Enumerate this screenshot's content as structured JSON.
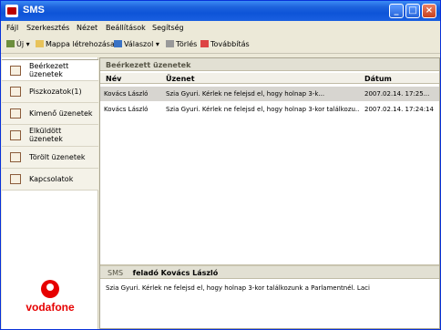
{
  "window": {
    "title": "SMS"
  },
  "menu": [
    "Fájl",
    "Szerkesztés",
    "Nézet",
    "Beállítások",
    "Segítség"
  ],
  "toolbar": {
    "new_label": "Új",
    "new_folder_label": "Mappa létrehozása",
    "reply_label": "Válaszol",
    "delete_label": "Törlés",
    "forward_label": "Továbbítás"
  },
  "sidebar": {
    "items": [
      {
        "label": "Beérkezett üzenetek",
        "active": true
      },
      {
        "label": "Piszkozatok(1)"
      },
      {
        "label": "Kimenő üzenetek"
      },
      {
        "label": "Elküldött üzenetek"
      },
      {
        "label": "Törölt üzenetek"
      },
      {
        "label": "Kapcsolatok"
      }
    ],
    "brand": "vodafone"
  },
  "list": {
    "title": "Beérkezett üzenetek",
    "columns": [
      "Név",
      "Üzenet",
      "Dátum"
    ],
    "rows": [
      {
        "name": "Kovács László",
        "message": "Szia Gyuri. Kérlek ne felejsd el, hogy holnap 3-k...",
        "date": "2007.02.14. 17:25..."
      },
      {
        "name": "Kovács László",
        "message": "Szia Gyuri. Kérlek ne felejsd el, hogy holnap 3-kor találkozu...",
        "date": "2007.02.14. 17:24:14"
      }
    ]
  },
  "preview": {
    "prefix": "SMS",
    "sender": "feladó Kovács László",
    "body": "Szia Gyuri. Kérlek ne felejsd el, hogy holnap 3-kor találkozunk a Parlamentnél. Laci"
  },
  "colors": {
    "titlebar": "#0d54d8",
    "brand": "#e60000"
  }
}
